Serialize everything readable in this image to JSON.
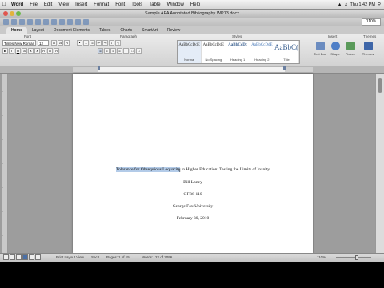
{
  "menubar": {
    "items": [
      "Word",
      "File",
      "Edit",
      "View",
      "Insert",
      "Format",
      "Font",
      "Tools",
      "Table",
      "Window",
      "Help"
    ],
    "clock": "Thu 1:42 PM"
  },
  "window": {
    "title": "Sample APA Annotated Bibliography WP13.docx"
  },
  "toolbar": {
    "zoom": "110%"
  },
  "ribbon": {
    "tabs": [
      "Home",
      "Layout",
      "Document Elements",
      "Tables",
      "Charts",
      "SmartArt",
      "Review"
    ],
    "active_tab": "Home",
    "groups": {
      "font": "Font",
      "paragraph": "Paragraph",
      "styles": "Styles",
      "insert": "Insert",
      "themes": "Themes"
    },
    "font_name": "Times New Roman",
    "font_size": "12",
    "styles": [
      {
        "sample": "AaBbCcDdE",
        "name": "Normal"
      },
      {
        "sample": "AaBbCcDdE",
        "name": "No Spacing"
      },
      {
        "sample": "AaBbCcDc",
        "name": "Heading 1"
      },
      {
        "sample": "AaBbCcDdE",
        "name": "Heading 2"
      },
      {
        "sample": "AaBbC(",
        "name": "Title"
      }
    ],
    "insert_buttons": [
      {
        "label": "Text Box",
        "icon": "textbox-icon",
        "color": "#6b8cc0"
      },
      {
        "label": "Shape",
        "icon": "shape-icon",
        "color": "#4f7fc7"
      },
      {
        "label": "Picture",
        "icon": "picture-icon",
        "color": "#5a9a5a"
      },
      {
        "label": "Themes",
        "icon": "themes-icon",
        "color": "#3e66a8"
      }
    ]
  },
  "document": {
    "title_selected": "Tolerance for Obsequious Loquacity",
    "title_rest": " in Higher Education: Testing the Limits of Inanity",
    "author": "Bill Loney",
    "course": "GFBS 110",
    "institution": "George Fox University",
    "date": "February 30, 2010"
  },
  "statusbar": {
    "view": "Print Layout View",
    "section": "Sec",
    "section_num": "1",
    "pages_label": "Pages:",
    "pages": "1 of 15",
    "words_label": "Words:",
    "words": "22 of 2096",
    "zoom": "110%"
  },
  "colors": {
    "selection": "#b3cbe8",
    "accent": "#3d6fd0"
  }
}
